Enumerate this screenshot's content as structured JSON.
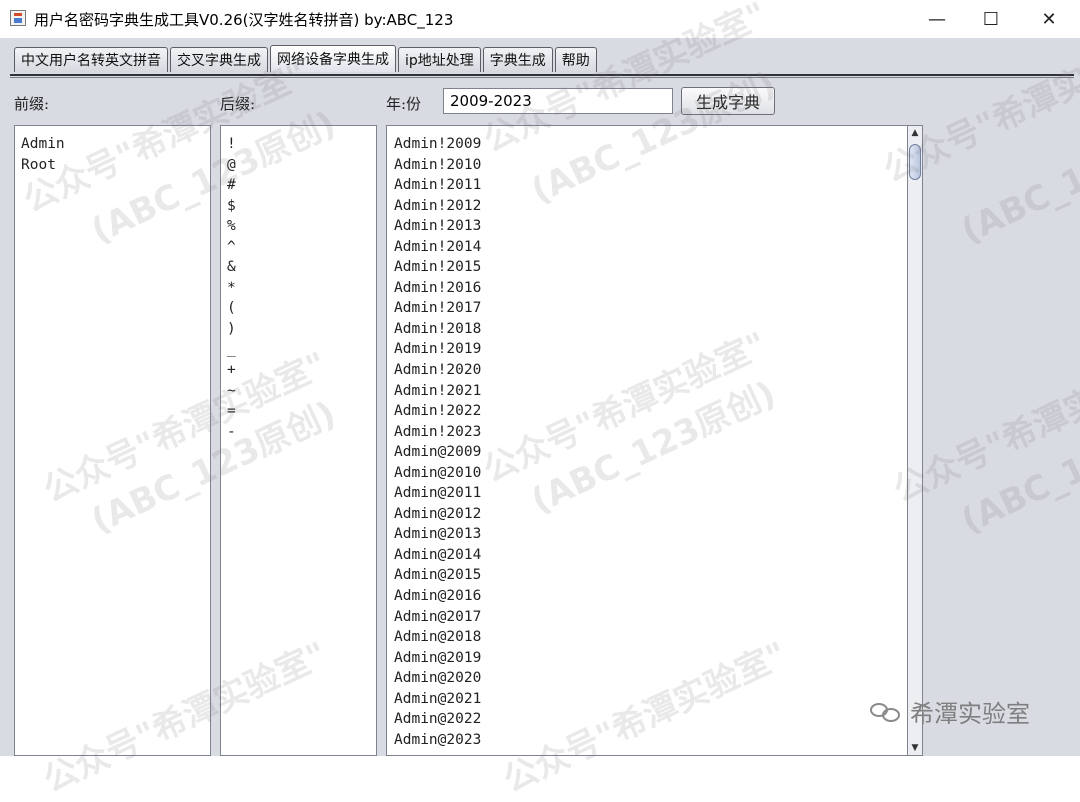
{
  "window": {
    "title": "用户名密码字典生成工具V0.26(汉字姓名转拼音) by:ABC_123",
    "minimize": "—",
    "maximize": "☐",
    "close": "✕"
  },
  "tabs": [
    {
      "label": "中文用户名转英文拼音",
      "active": false
    },
    {
      "label": "交叉字典生成",
      "active": false
    },
    {
      "label": "网络设备字典生成",
      "active": true
    },
    {
      "label": "ip地址处理",
      "active": false
    },
    {
      "label": "字典生成",
      "active": false
    },
    {
      "label": "帮助",
      "active": false
    }
  ],
  "form": {
    "prefix_label": "前缀:",
    "suffix_label": "后缀:",
    "year_label": "年:份",
    "year_value": "2009-2023",
    "generate_label": "生成字典"
  },
  "prefix_lines": [
    "Admin",
    "Root"
  ],
  "suffix_lines": [
    "!",
    "@",
    "#",
    "$",
    "%",
    "^",
    "&",
    "*",
    "(",
    ")",
    "_",
    "+",
    "~",
    "=",
    "-"
  ],
  "output_lines": [
    "Admin!2009",
    "Admin!2010",
    "Admin!2011",
    "Admin!2012",
    "Admin!2013",
    "Admin!2014",
    "Admin!2015",
    "Admin!2016",
    "Admin!2017",
    "Admin!2018",
    "Admin!2019",
    "Admin!2020",
    "Admin!2021",
    "Admin!2022",
    "Admin!2023",
    "Admin@2009",
    "Admin@2010",
    "Admin@2011",
    "Admin@2012",
    "Admin@2013",
    "Admin@2014",
    "Admin@2015",
    "Admin@2016",
    "Admin@2017",
    "Admin@2018",
    "Admin@2019",
    "Admin@2020",
    "Admin@2021",
    "Admin@2022",
    "Admin@2023"
  ],
  "watermarks": [
    "公众号\"希潭实验室\"",
    "(ABC_123原创)"
  ],
  "wechat_label": "希潭实验室"
}
